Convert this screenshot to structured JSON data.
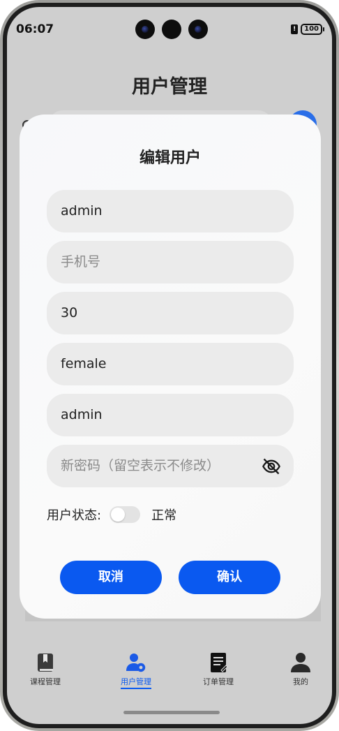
{
  "status_bar": {
    "time": "06:07",
    "battery": "100",
    "sim_glyph": "!"
  },
  "page": {
    "title": "用户管理"
  },
  "dialog": {
    "title": "编辑用户",
    "fields": {
      "username": {
        "value": "admin",
        "placeholder": ""
      },
      "phone": {
        "value": "",
        "placeholder": "手机号"
      },
      "age": {
        "value": "30",
        "placeholder": ""
      },
      "gender": {
        "value": "female",
        "placeholder": ""
      },
      "role": {
        "value": "admin",
        "placeholder": ""
      },
      "password": {
        "value": "",
        "placeholder": "新密码（留空表示不修改）",
        "icon": "eye-off-icon"
      }
    },
    "status": {
      "label": "用户状态:",
      "toggle_on": false,
      "value_text": "正常"
    },
    "buttons": {
      "cancel": "取消",
      "confirm": "确认"
    },
    "accent_color": "#0a59f0"
  },
  "tabbar": {
    "tabs": [
      {
        "label": "课程管理",
        "icon": "book-icon",
        "active": false
      },
      {
        "label": "用户管理",
        "icon": "user-settings-icon",
        "active": true
      },
      {
        "label": "订单管理",
        "icon": "document-icon",
        "active": false
      },
      {
        "label": "我的",
        "icon": "person-icon",
        "active": false
      }
    ]
  }
}
